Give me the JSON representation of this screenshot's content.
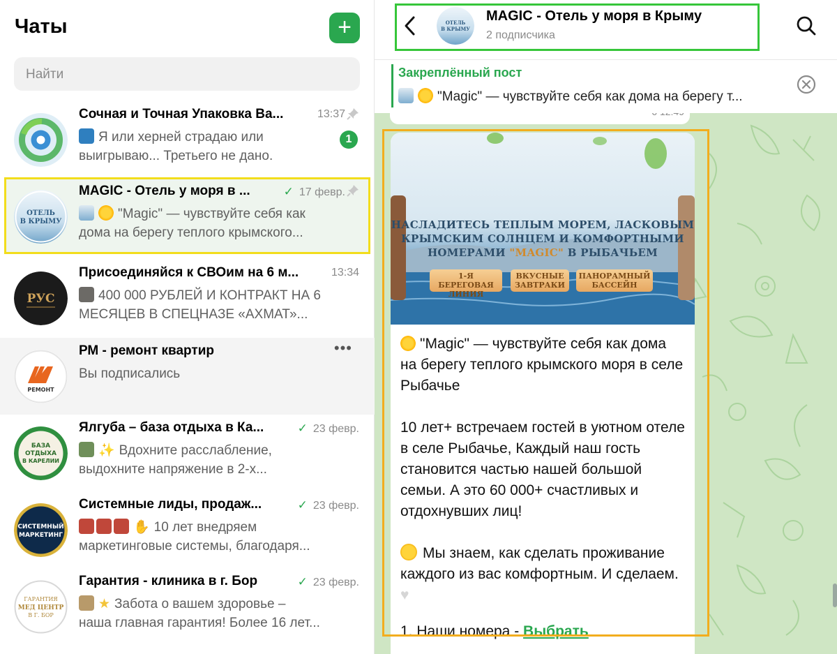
{
  "sidebar": {
    "title": "Чаты",
    "compose_label": "+",
    "search_placeholder": "Найти",
    "chats": [
      {
        "name": "Сочная и Точная Упаковка Ва...",
        "time": "13:37",
        "pinned": true,
        "badge": "1",
        "preview_line1": "Я или херней страдаю или",
        "preview_line2": "выигрываю... Третьего не дано."
      },
      {
        "name": "MAGIC - Отель у моря в ...",
        "time": "17 февр.",
        "read": true,
        "pinned": true,
        "avatar_text": "ОТЕЛЬ В КРЫМУ",
        "preview_line1": "\"Magic\" — чувствуйте себя как",
        "preview_line2": "дома на берегу теплого крымского..."
      },
      {
        "name": "Присоединяйся к СВОим на 6 м...",
        "time": "13:34",
        "avatar_text": "РУС",
        "preview_line1": "400 000 РУБЛЕЙ И КОНТРАКТ НА 6",
        "preview_line2": "МЕСЯЦЕВ В СПЕЦНАЗЕ «АХМАТ»..."
      },
      {
        "name": "РМ - ремонт квартир",
        "more": "•••",
        "avatar_text": "РМ",
        "avatar_sub": "РЕМОНТ",
        "preview_line1": "Вы подписались",
        "preview_line2": ""
      },
      {
        "name": "Ялгуба – база отдыха в Ка...",
        "time": "23 февр.",
        "read": true,
        "avatar_text": "БАЗА ОТДЫХА В КАРЕЛИИ",
        "preview_line1": "Вдохните расслабление,",
        "preview_line2": "выдохните напряжение в 2-х..."
      },
      {
        "name": "Системные лиды, продаж...",
        "time": "23 февр.",
        "read": true,
        "avatar_text": "СИСТЕМНЫЙ МАРКЕТИНГ",
        "preview_line1": "10 лет внедряем",
        "preview_line2": "маркетинговые системы, благодаря..."
      },
      {
        "name": "Гарантия - клиника в г. Бор",
        "time": "23 февр.",
        "read": true,
        "avatar_text": "ГАРАНТИЯ МЕД ЦЕНТР В Г. БОР",
        "preview_line1": "Забота о вашем здоровье –",
        "preview_line2": "наша главная гарантия! Более 16 лет..."
      }
    ]
  },
  "channel": {
    "title": "MAGIC - Отель у моря в Крыму",
    "subscribers": "2 подписчика",
    "avatar_text": "ОТЕЛЬ В КРЫМУ",
    "pinned_title": "Закреплённый пост",
    "pinned_text": "\"Magic\" — чувствуйте себя как дома на берегу т...",
    "prev_meta": "6   12:49"
  },
  "post": {
    "banner_line1": "НАСЛАДИТЕСЬ ТЕПЛЫМ МОРЕМ, ЛАСКОВЫМ",
    "banner_line2": "КРЫМСКИМ СОЛНЦЕМ И КОМФОРТНЫМИ",
    "banner_line3_a": "НОМЕРАМИ ",
    "banner_line3_b": "\"MAGIC\"",
    "banner_line3_c": " В РЫБАЧЬЕМ",
    "pill1": "1-Я БЕРЕГОВАЯ ЛИНИЯ",
    "pill2": "ВКУСНЫЕ ЗАВТРАКИ",
    "pill3": "ПАНОРАМНЫЙ БАССЕЙН",
    "para1": "\"Magic\" — чувствуйте себя как дома на берегу теплого крымского моря в селе Рыбачье",
    "para2": "10 лет+ встречаем гостей в уютном отеле в селе Рыбачье, Каждый наш гость становится частью нашей большой семьи. А это 60 000+ счастливых и отдохнувших лиц!",
    "para3": "Мы знаем, как сделать проживание каждого из вас комфортным. И сделаем.",
    "list1_prefix": "1. Наши номера - ",
    "list1_link": "Выбрать"
  }
}
